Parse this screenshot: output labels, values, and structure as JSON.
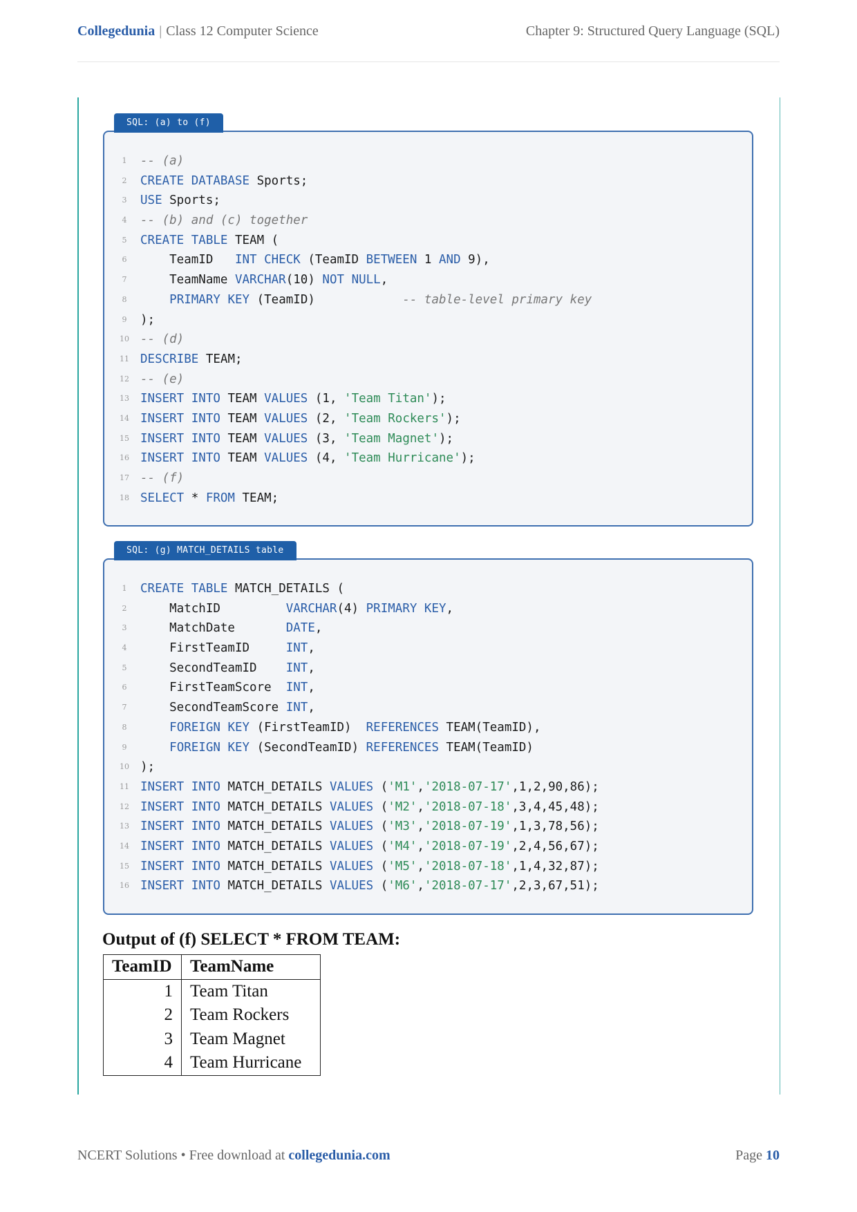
{
  "header": {
    "brand": "Collegedunia",
    "separator": "|",
    "course": "Class 12 Computer Science",
    "chapter": "Chapter 9: Structured Query Language (SQL)"
  },
  "box1": {
    "title": "SQL: (a) to (f)",
    "lines": [
      [
        {
          "t": "-- (a)",
          "c": "cm"
        }
      ],
      [
        {
          "t": "CREATE DATABASE",
          "c": "kw"
        },
        {
          "t": " Sports;",
          "c": ""
        }
      ],
      [
        {
          "t": "USE",
          "c": "kw"
        },
        {
          "t": " Sports;",
          "c": ""
        }
      ],
      [
        {
          "t": "-- (b) and (c) together",
          "c": "cm"
        }
      ],
      [
        {
          "t": "CREATE TABLE",
          "c": "kw"
        },
        {
          "t": " TEAM (",
          "c": ""
        }
      ],
      [
        {
          "t": "    TeamID   ",
          "c": ""
        },
        {
          "t": "INT CHECK",
          "c": "kw"
        },
        {
          "t": " (TeamID ",
          "c": ""
        },
        {
          "t": "BETWEEN",
          "c": "kw"
        },
        {
          "t": " 1 ",
          "c": ""
        },
        {
          "t": "AND",
          "c": "kw"
        },
        {
          "t": " 9),",
          "c": ""
        }
      ],
      [
        {
          "t": "    TeamName ",
          "c": ""
        },
        {
          "t": "VARCHAR",
          "c": "kw"
        },
        {
          "t": "(10) ",
          "c": ""
        },
        {
          "t": "NOT NULL",
          "c": "kw"
        },
        {
          "t": ",",
          "c": ""
        }
      ],
      [
        {
          "t": "    ",
          "c": ""
        },
        {
          "t": "PRIMARY KEY",
          "c": "kw"
        },
        {
          "t": " (TeamID)            ",
          "c": ""
        },
        {
          "t": "-- table-level primary key",
          "c": "cm"
        }
      ],
      [
        {
          "t": ");",
          "c": ""
        }
      ],
      [
        {
          "t": "-- (d)",
          "c": "cm"
        }
      ],
      [
        {
          "t": "DESCRIBE",
          "c": "kw"
        },
        {
          "t": " TEAM;",
          "c": ""
        }
      ],
      [
        {
          "t": "-- (e)",
          "c": "cm"
        }
      ],
      [
        {
          "t": "INSERT INTO",
          "c": "kw"
        },
        {
          "t": " TEAM ",
          "c": ""
        },
        {
          "t": "VALUES",
          "c": "kw"
        },
        {
          "t": " (1, ",
          "c": ""
        },
        {
          "t": "'Team Titan'",
          "c": "str"
        },
        {
          "t": ");",
          "c": ""
        }
      ],
      [
        {
          "t": "INSERT INTO",
          "c": "kw"
        },
        {
          "t": " TEAM ",
          "c": ""
        },
        {
          "t": "VALUES",
          "c": "kw"
        },
        {
          "t": " (2, ",
          "c": ""
        },
        {
          "t": "'Team Rockers'",
          "c": "str"
        },
        {
          "t": ");",
          "c": ""
        }
      ],
      [
        {
          "t": "INSERT INTO",
          "c": "kw"
        },
        {
          "t": " TEAM ",
          "c": ""
        },
        {
          "t": "VALUES",
          "c": "kw"
        },
        {
          "t": " (3, ",
          "c": ""
        },
        {
          "t": "'Team Magnet'",
          "c": "str"
        },
        {
          "t": ");",
          "c": ""
        }
      ],
      [
        {
          "t": "INSERT INTO",
          "c": "kw"
        },
        {
          "t": " TEAM ",
          "c": ""
        },
        {
          "t": "VALUES",
          "c": "kw"
        },
        {
          "t": " (4, ",
          "c": ""
        },
        {
          "t": "'Team Hurricane'",
          "c": "str"
        },
        {
          "t": ");",
          "c": ""
        }
      ],
      [
        {
          "t": "-- (f)",
          "c": "cm"
        }
      ],
      [
        {
          "t": "SELECT",
          "c": "kw"
        },
        {
          "t": " * ",
          "c": ""
        },
        {
          "t": "FROM",
          "c": "kw"
        },
        {
          "t": " TEAM;",
          "c": ""
        }
      ]
    ]
  },
  "box2": {
    "title": "SQL: (g) MATCH_DETAILS table",
    "lines": [
      [
        {
          "t": "CREATE TABLE",
          "c": "kw"
        },
        {
          "t": " MATCH_DETAILS (",
          "c": ""
        }
      ],
      [
        {
          "t": "    MatchID         ",
          "c": ""
        },
        {
          "t": "VARCHAR",
          "c": "kw"
        },
        {
          "t": "(4) ",
          "c": ""
        },
        {
          "t": "PRIMARY KEY",
          "c": "kw"
        },
        {
          "t": ",",
          "c": ""
        }
      ],
      [
        {
          "t": "    MatchDate       ",
          "c": ""
        },
        {
          "t": "DATE",
          "c": "kw"
        },
        {
          "t": ",",
          "c": ""
        }
      ],
      [
        {
          "t": "    FirstTeamID     ",
          "c": ""
        },
        {
          "t": "INT",
          "c": "kw"
        },
        {
          "t": ",",
          "c": ""
        }
      ],
      [
        {
          "t": "    SecondTeamID    ",
          "c": ""
        },
        {
          "t": "INT",
          "c": "kw"
        },
        {
          "t": ",",
          "c": ""
        }
      ],
      [
        {
          "t": "    FirstTeamScore  ",
          "c": ""
        },
        {
          "t": "INT",
          "c": "kw"
        },
        {
          "t": ",",
          "c": ""
        }
      ],
      [
        {
          "t": "    SecondTeamScore ",
          "c": ""
        },
        {
          "t": "INT",
          "c": "kw"
        },
        {
          "t": ",",
          "c": ""
        }
      ],
      [
        {
          "t": "    ",
          "c": ""
        },
        {
          "t": "FOREIGN KEY",
          "c": "kw"
        },
        {
          "t": " (FirstTeamID)  ",
          "c": ""
        },
        {
          "t": "REFERENCES",
          "c": "kw"
        },
        {
          "t": " TEAM(TeamID),",
          "c": ""
        }
      ],
      [
        {
          "t": "    ",
          "c": ""
        },
        {
          "t": "FOREIGN KEY",
          "c": "kw"
        },
        {
          "t": " (SecondTeamID) ",
          "c": ""
        },
        {
          "t": "REFERENCES",
          "c": "kw"
        },
        {
          "t": " TEAM(TeamID)",
          "c": ""
        }
      ],
      [
        {
          "t": ");",
          "c": ""
        }
      ],
      [
        {
          "t": "INSERT INTO",
          "c": "kw"
        },
        {
          "t": " MATCH_DETAILS ",
          "c": ""
        },
        {
          "t": "VALUES",
          "c": "kw"
        },
        {
          "t": " (",
          "c": ""
        },
        {
          "t": "'M1'",
          "c": "str"
        },
        {
          "t": ",",
          "c": ""
        },
        {
          "t": "'2018-07-17'",
          "c": "str"
        },
        {
          "t": ",1,2,90,86);",
          "c": ""
        }
      ],
      [
        {
          "t": "INSERT INTO",
          "c": "kw"
        },
        {
          "t": " MATCH_DETAILS ",
          "c": ""
        },
        {
          "t": "VALUES",
          "c": "kw"
        },
        {
          "t": " (",
          "c": ""
        },
        {
          "t": "'M2'",
          "c": "str"
        },
        {
          "t": ",",
          "c": ""
        },
        {
          "t": "'2018-07-18'",
          "c": "str"
        },
        {
          "t": ",3,4,45,48);",
          "c": ""
        }
      ],
      [
        {
          "t": "INSERT INTO",
          "c": "kw"
        },
        {
          "t": " MATCH_DETAILS ",
          "c": ""
        },
        {
          "t": "VALUES",
          "c": "kw"
        },
        {
          "t": " (",
          "c": ""
        },
        {
          "t": "'M3'",
          "c": "str"
        },
        {
          "t": ",",
          "c": ""
        },
        {
          "t": "'2018-07-19'",
          "c": "str"
        },
        {
          "t": ",1,3,78,56);",
          "c": ""
        }
      ],
      [
        {
          "t": "INSERT INTO",
          "c": "kw"
        },
        {
          "t": " MATCH_DETAILS ",
          "c": ""
        },
        {
          "t": "VALUES",
          "c": "kw"
        },
        {
          "t": " (",
          "c": ""
        },
        {
          "t": "'M4'",
          "c": "str"
        },
        {
          "t": ",",
          "c": ""
        },
        {
          "t": "'2018-07-19'",
          "c": "str"
        },
        {
          "t": ",2,4,56,67);",
          "c": ""
        }
      ],
      [
        {
          "t": "INSERT INTO",
          "c": "kw"
        },
        {
          "t": " MATCH_DETAILS ",
          "c": ""
        },
        {
          "t": "VALUES",
          "c": "kw"
        },
        {
          "t": " (",
          "c": ""
        },
        {
          "t": "'M5'",
          "c": "str"
        },
        {
          "t": ",",
          "c": ""
        },
        {
          "t": "'2018-07-18'",
          "c": "str"
        },
        {
          "t": ",1,4,32,87);",
          "c": ""
        }
      ],
      [
        {
          "t": "INSERT INTO",
          "c": "kw"
        },
        {
          "t": " MATCH_DETAILS ",
          "c": ""
        },
        {
          "t": "VALUES",
          "c": "kw"
        },
        {
          "t": " (",
          "c": ""
        },
        {
          "t": "'M6'",
          "c": "str"
        },
        {
          "t": ",",
          "c": ""
        },
        {
          "t": "'2018-07-17'",
          "c": "str"
        },
        {
          "t": ",2,3,67,51);",
          "c": ""
        }
      ]
    ]
  },
  "output": {
    "title": "Output of (f) SELECT * FROM TEAM:",
    "headers": [
      "TeamID",
      "TeamName"
    ],
    "rows": [
      [
        "1",
        "Team Titan"
      ],
      [
        "2",
        "Team Rockers"
      ],
      [
        "3",
        "Team Magnet"
      ],
      [
        "4",
        "Team Hurricane"
      ]
    ]
  },
  "footer": {
    "left_text": "NCERT Solutions • Free download at ",
    "link": "collegedunia.com",
    "page_label": "Page ",
    "page_number": "10"
  },
  "colors": {
    "accent": "#2a5da8",
    "teal_rule": "#2aa6a0",
    "keyword": "#2a5da8",
    "string": "#2e8b57",
    "comment": "#777777"
  }
}
